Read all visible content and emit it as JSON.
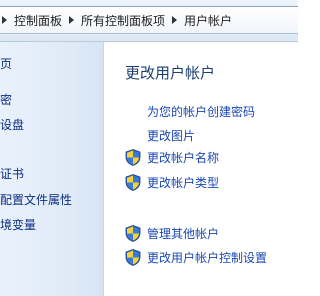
{
  "address_bar": {
    "breadcrumb": [
      {
        "label": "控制面板"
      },
      {
        "label": "所有控制面板项"
      },
      {
        "label": "用户帐户"
      }
    ]
  },
  "nav_pane": {
    "items": [
      {
        "label": "页"
      },
      {
        "label": "密"
      },
      {
        "label": "设盘"
      },
      {
        "label": "证书"
      },
      {
        "label": "配置文件属性"
      },
      {
        "label": "境变量"
      }
    ]
  },
  "main": {
    "title": "更改用户帐户",
    "links": {
      "create_password": "为您的帐户创建密码",
      "change_picture": "更改图片"
    },
    "admin_tasks": [
      {
        "label": "更改帐户名称",
        "icon": "uac-shield-icon"
      },
      {
        "label": "更改帐户类型",
        "icon": "uac-shield-icon"
      }
    ],
    "other_tasks": [
      {
        "label": "管理其他帐户",
        "icon": "uac-shield-icon"
      },
      {
        "label": "更改用户帐户控制设置",
        "icon": "uac-shield-icon"
      }
    ]
  },
  "colors": {
    "link": "#1a47b5",
    "title": "#1d3f72",
    "nav_link": "#0c2e82",
    "nav_bg": "#e3edf9"
  }
}
